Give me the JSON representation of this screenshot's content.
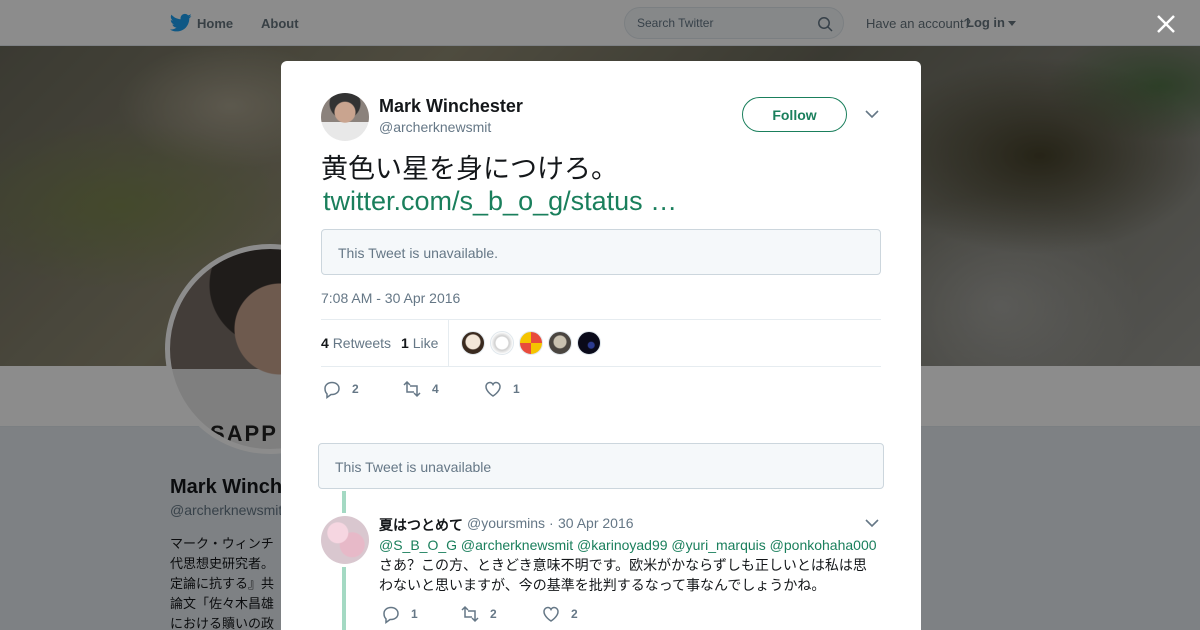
{
  "nav": {
    "home_label": "Home",
    "about_label": "About",
    "search_placeholder": "Search Twitter",
    "have_account": "Have an account?",
    "login_label": "Log in"
  },
  "profile": {
    "name": "Mark Winch",
    "handle": "@archerknewsmit",
    "bio": "マーク・ウィンチ\n代思想史研究者。\n定論に抗する』共\n論文「佐々木昌雄\nにおける贖いの政",
    "shirt_text": "SAPP"
  },
  "tweet": {
    "author_name": "Mark Winchester",
    "author_handle": "@archerknewsmit",
    "follow_label": "Follow",
    "text": "黄色い星を身につけろ。",
    "link": "twitter.com/s_b_o_g/status …",
    "quote_unavailable": "This Tweet is unavailable.",
    "timestamp": "7:08 AM - 30 Apr 2016",
    "retweets_count": "4",
    "retweets_label": "Retweets",
    "likes_count": "1",
    "likes_label": "Like",
    "actions": {
      "replies": "2",
      "retweets": "4",
      "likes": "1"
    }
  },
  "thread": {
    "unavailable_text": "This Tweet is unavailable",
    "reply": {
      "name": "夏はつとめて",
      "handle": "@yoursmins",
      "separator": "·",
      "date": "30 Apr 2016",
      "mentions": "@S_B_O_G @archerknewsmit @karinoyad99 @yuri_marquis @ponkohaha000",
      "body": "さあ？この方、ときどき意味不明です。欧米がかならずしも正しいとは私は思わないと思いますが、今の基準を批判するなって事なんでしょうかね。",
      "actions": {
        "replies": "1",
        "retweets": "2",
        "likes": "2"
      }
    }
  },
  "colors": {
    "accent": "#1a7f5c",
    "nav_bird": "#1da1f2",
    "thread_line": "#a4d9c3"
  }
}
